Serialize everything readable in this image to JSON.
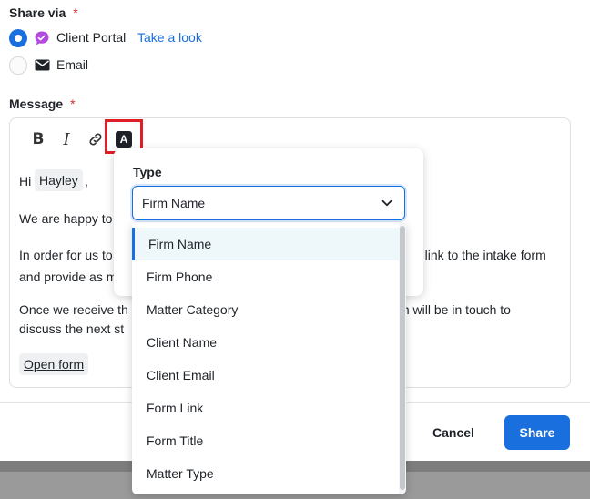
{
  "share_via": {
    "label": "Share via",
    "required_mark": "*",
    "options": [
      {
        "label": "Client Portal",
        "selected": true,
        "link": "Take a look",
        "icon": "chat-bubble-icon",
        "icon_color": "#b34bde"
      },
      {
        "label": "Email",
        "selected": false,
        "icon": "envelope-icon"
      }
    ]
  },
  "message": {
    "label": "Message",
    "required_mark": "*",
    "toolbar": {
      "bold": "B",
      "italic": "I",
      "insert_variable": "A"
    },
    "body": {
      "greeting_prefix": "Hi",
      "name_chip": "Hayley",
      "greeting_suffix": ",",
      "line2": "We are happy to",
      "line3a_left": "In order for us to",
      "line3a_right": "e link to the intake form",
      "line3b": "and provide as m",
      "line4a_left": "Once we receive th",
      "line4a_right": "m will be in touch to",
      "line4b": "discuss the next st",
      "form_chip": "Open form"
    }
  },
  "popover": {
    "title": "Type",
    "selected": "Firm Name",
    "options": [
      "Firm Name",
      "Firm Phone",
      "Matter Category",
      "Client Name",
      "Client Email",
      "Form Link",
      "Form Title",
      "Matter Type"
    ]
  },
  "footer": {
    "cancel": "Cancel",
    "share": "Share"
  },
  "colors": {
    "accent": "#1a6fde",
    "required": "#d12c2c",
    "highlight": "#e01e26"
  }
}
